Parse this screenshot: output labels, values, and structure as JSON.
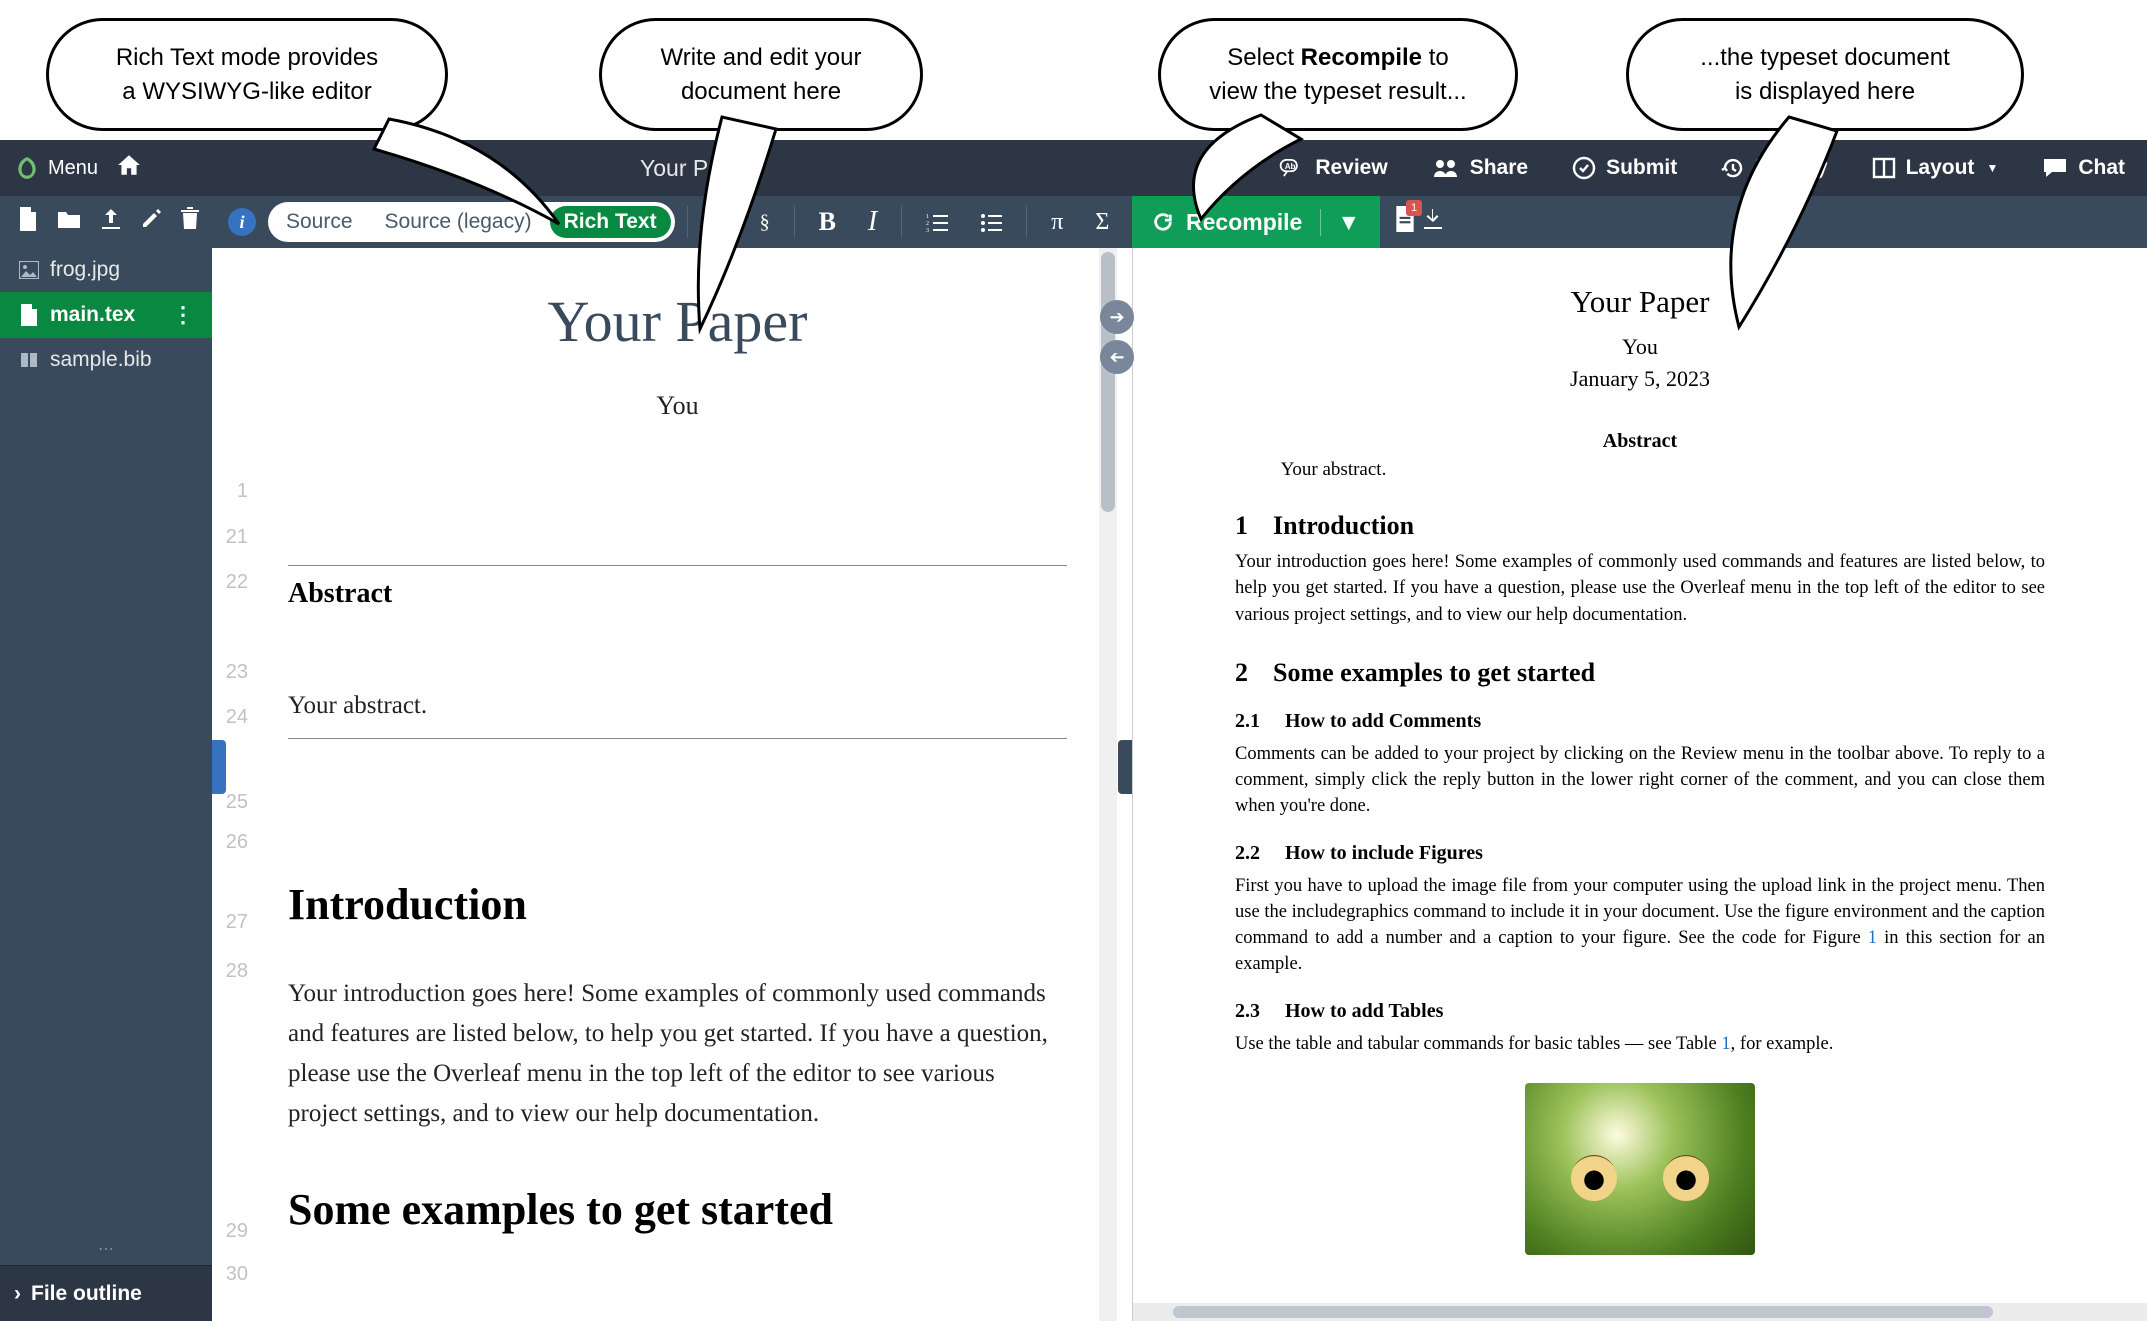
{
  "callouts": {
    "rich_text": "Rich Text mode provides\na WYSIWYG-like editor",
    "write_edit": "Write and edit your\ndocument here",
    "recompile": "Select Recompile to\nview the typeset result...",
    "recompile_strong": "Recompile",
    "typeset": "...the typeset document\nis displayed here"
  },
  "topnav": {
    "menu": "Menu",
    "title": "Your Paper",
    "review": "Review",
    "share": "Share",
    "submit": "Submit",
    "history": "History",
    "layout": "Layout",
    "chat": "Chat"
  },
  "modes": {
    "source": "Source",
    "legacy": "Source (legacy)",
    "rich": "Rich Text"
  },
  "recompile_btn": "Recompile",
  "files": {
    "f1": "frog.jpg",
    "f2": "main.tex",
    "f3": "sample.bib"
  },
  "outline": "File outline",
  "editor": {
    "title": "Your Paper",
    "author": "You",
    "abstract_h": "Abstract",
    "abstract_t": "Your abstract.",
    "intro_h": "Introduction",
    "intro_p": "Your introduction goes here! Some examples of commonly used commands and features are listed below, to help you get started. If you have a question, please use the Overleaf menu in the top left of the editor to see various project settings, and to view our help documentation.",
    "some_h": "Some examples to get started",
    "lines": {
      "l1": "1",
      "l21": "21",
      "l22": "22",
      "l23": "23",
      "l24": "24",
      "l25": "25",
      "l26": "26",
      "l27": "27",
      "l28": "28",
      "l29": "29",
      "l30": "30"
    }
  },
  "pdf": {
    "title": "Your Paper",
    "author": "You",
    "date": "January 5, 2023",
    "abs_h": "Abstract",
    "abs_t": "Your abstract.",
    "s1_h": "Introduction",
    "s1_n": "1",
    "s1_p": "Your introduction goes here! Some examples of commonly used commands and features are listed below, to help you get started. If you have a question, please use the Overleaf menu in the top left of the editor to see various project settings, and to view our help documentation.",
    "s2_h": "Some examples to get started",
    "s2_n": "2",
    "s21_n": "2.1",
    "s21_h": "How to add Comments",
    "s21_p": "Comments can be added to your project by clicking on the Review menu in the toolbar above. To reply to a comment, simply click the reply button in the lower right corner of the comment, and you can close them when you're done.",
    "s22_n": "2.2",
    "s22_h": "How to include Figures",
    "s22_p_a": "First you have to upload the image file from your computer using the upload link in the project menu. Then use the includegraphics command to include it in your document. Use the figure environment and the caption command to add a number and a caption to your figure. See the code for Figure ",
    "s22_link": "1",
    "s22_p_b": " in this section for an example.",
    "s23_n": "2.3",
    "s23_h": "How to add Tables",
    "s23_p_a": "Use the table and tabular commands for basic tables — see Table ",
    "s23_link": "1",
    "s23_p_b": ", for example."
  },
  "log_badge": "1"
}
